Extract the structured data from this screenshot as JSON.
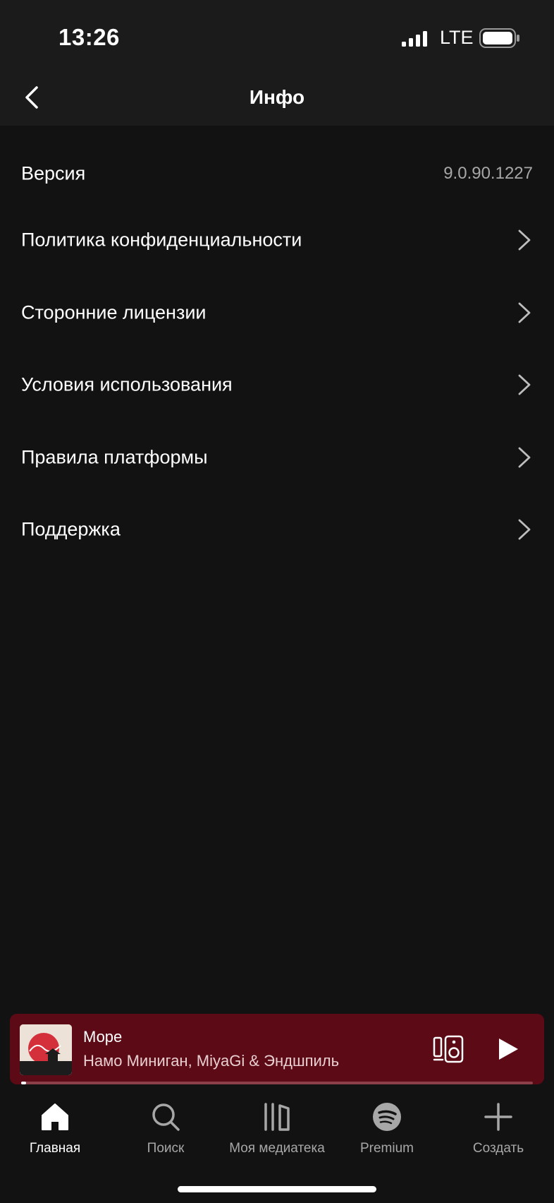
{
  "status_bar": {
    "time": "13:26",
    "network": "LTE"
  },
  "header": {
    "title": "Инфо"
  },
  "info_rows": [
    {
      "label": "Версия",
      "value": "9.0.90.1227"
    },
    {
      "label": "Политика конфиденциальности"
    },
    {
      "label": "Сторонние лицензии"
    },
    {
      "label": "Условия использования"
    },
    {
      "label": "Правила платформы"
    },
    {
      "label": "Поддержка"
    }
  ],
  "now_playing": {
    "track": "Море",
    "artist": "Намо Миниган, MiyaGi & Эндшпиль",
    "progress": 0.01,
    "background_color": "#5c0a15"
  },
  "tabs": [
    {
      "label": "Главная",
      "icon": "home-icon",
      "active": true
    },
    {
      "label": "Поиск",
      "icon": "search-icon",
      "active": false
    },
    {
      "label": "Моя медиатека",
      "icon": "library-icon",
      "active": false
    },
    {
      "label": "Premium",
      "icon": "spotify-logo-icon",
      "active": false
    },
    {
      "label": "Создать",
      "icon": "plus-icon",
      "active": false
    }
  ],
  "colors": {
    "background": "#121212",
    "header": "#1b1b1b",
    "secondary_text": "#a7a7a7"
  }
}
